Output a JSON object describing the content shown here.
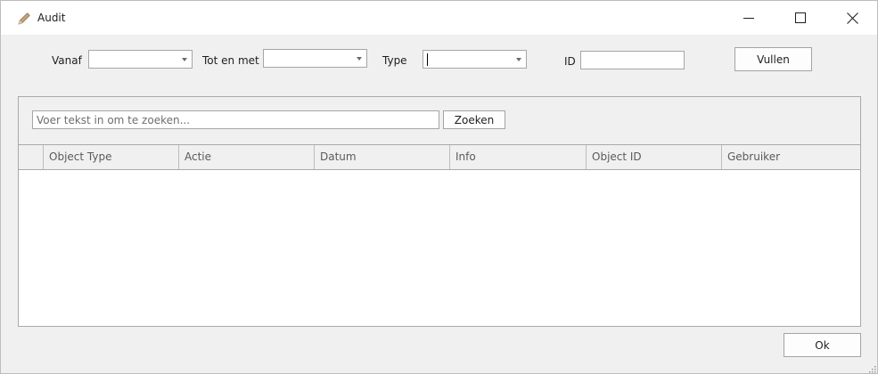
{
  "window": {
    "title": "Audit",
    "icon": "pencil-icon"
  },
  "filters": {
    "from_label": "Vanaf",
    "from_value": "",
    "until_label": "Tot en met",
    "until_value": "",
    "type_label": "Type",
    "type_value": "",
    "id_label": "ID",
    "id_value": "",
    "fill_button": "Vullen"
  },
  "search": {
    "placeholder": "Voer tekst in om te zoeken...",
    "value": "",
    "button": "Zoeken"
  },
  "grid": {
    "columns": [
      "Object Type",
      "Actie",
      "Datum",
      "Info",
      "Object ID",
      "Gebruiker"
    ],
    "rows": []
  },
  "footer": {
    "ok_button": "Ok"
  }
}
